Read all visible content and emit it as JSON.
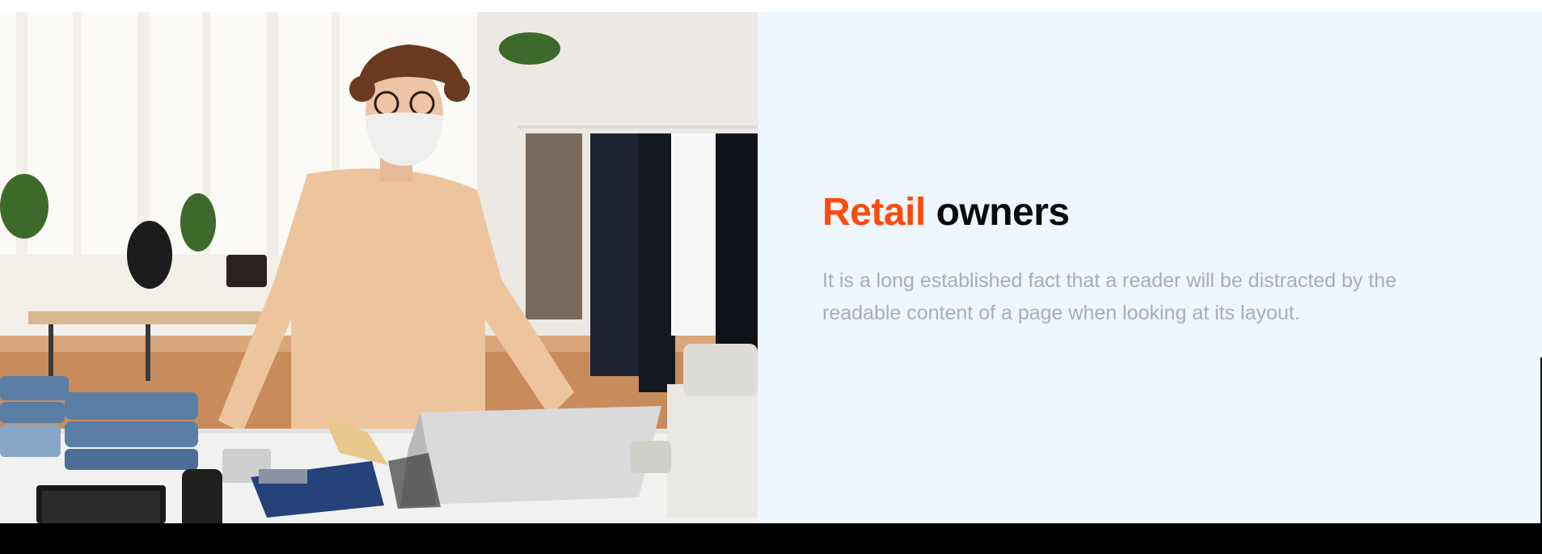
{
  "feature": {
    "title_accent": "Retail",
    "title_rest": "owners",
    "description": "It is a long established fact that a reader will be distracted by the readable content of a page when looking at its layout.",
    "image_subject": "retail-owner-photo",
    "colors": {
      "accent": "#ff4a0d",
      "title": "#0b0b0b",
      "description": "#a9aeb6",
      "panel_background": "#eef6fe",
      "footer": "#000000"
    }
  }
}
